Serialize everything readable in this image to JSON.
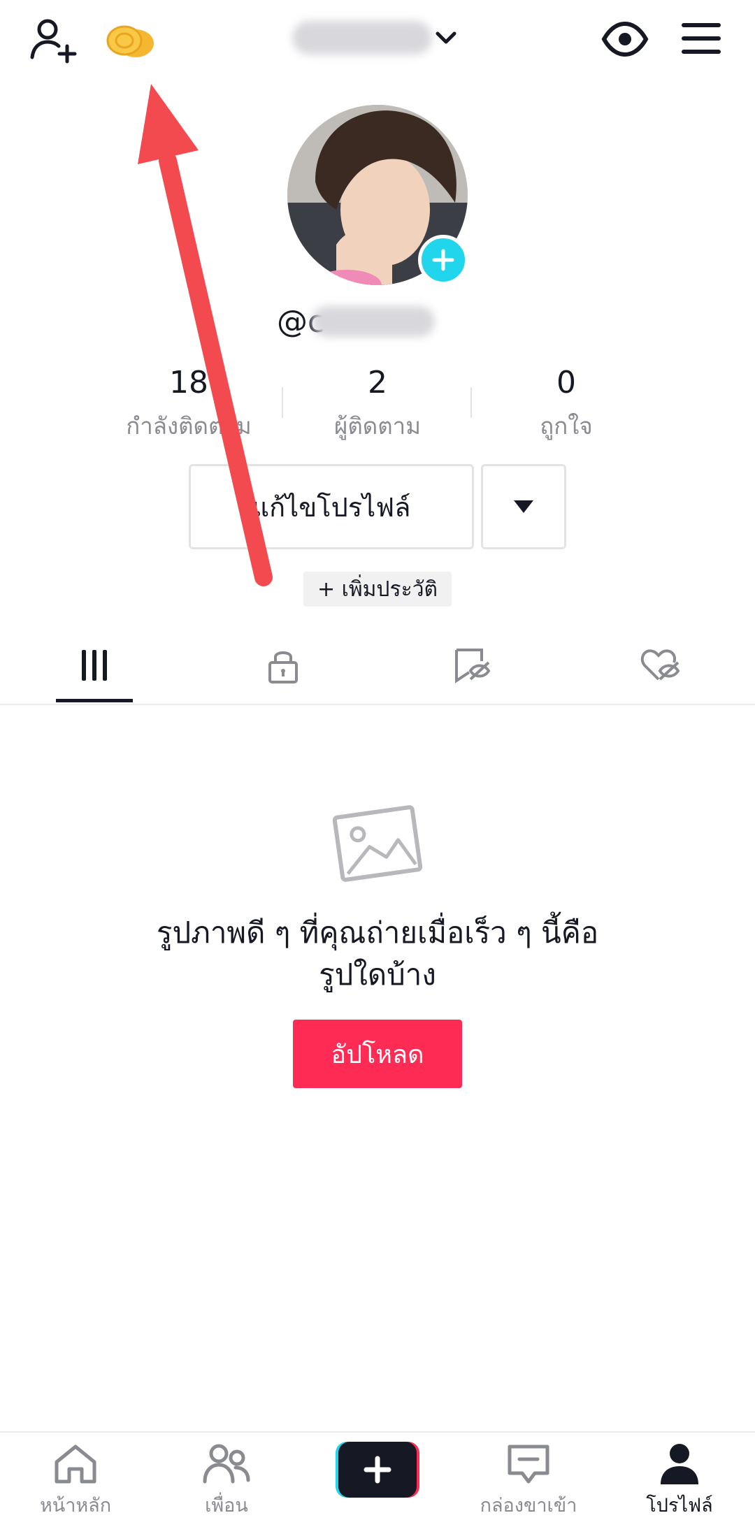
{
  "header": {
    "add_friend_icon": "person-plus-icon",
    "coins_icon": "coins-icon",
    "username_dropdown_icon": "chevron-down-icon",
    "view_icon": "eye-icon",
    "menu_icon": "hamburger-menu-icon"
  },
  "profile": {
    "handle": "@c",
    "avatar_add_icon": "plus-icon"
  },
  "stats": [
    {
      "value": "18",
      "label": "กำลังติดตาม"
    },
    {
      "value": "2",
      "label": "ผู้ติดตาม"
    },
    {
      "value": "0",
      "label": "ถูกใจ"
    }
  ],
  "actions": {
    "edit_profile": "แก้ไขโปรไฟล์",
    "more_icon": "triangle-down-icon",
    "add_bio": "+ เพิ่มประวัติ"
  },
  "tabs": [
    {
      "icon": "grid-icon",
      "active": true
    },
    {
      "icon": "lock-icon",
      "active": false
    },
    {
      "icon": "bookmark-hidden-icon",
      "active": false
    },
    {
      "icon": "heart-hidden-icon",
      "active": false
    }
  ],
  "empty_state": {
    "icon": "image-icon",
    "line1": "รูปภาพดี ๆ ที่คุณถ่ายเมื่อเร็ว ๆ นี้คือ",
    "line2": "รูปใดบ้าง",
    "upload_label": "อัปโหลด"
  },
  "bottom_nav": [
    {
      "label": "หน้าหลัก",
      "icon": "home-icon"
    },
    {
      "label": "เพื่อน",
      "icon": "friends-icon"
    },
    {
      "label": "",
      "icon": "create-plus-icon"
    },
    {
      "label": "กล่องขาเข้า",
      "icon": "inbox-icon"
    },
    {
      "label": "โปรไฟล์",
      "icon": "profile-icon"
    }
  ],
  "colors": {
    "accent": "#fe2c55",
    "cyan": "#20d5ec",
    "arrow": "#f24a4f",
    "text": "#161823",
    "muted": "#8a8b91"
  }
}
